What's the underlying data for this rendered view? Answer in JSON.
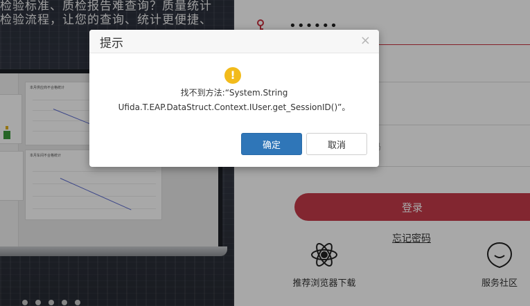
{
  "promo": {
    "line1": "检验标准、质检报告难查询？质量统计",
    "line2": "检验流程，让您的查询、统计更便捷、"
  },
  "laptop_cards": {
    "card1_title": "本月供应商不合格统计",
    "card2_title": "本月车间不合格统计",
    "card3_title": "本月车间不合格统计"
  },
  "login": {
    "password_value": "••••••",
    "login_button": "登录",
    "forgot_password": "忘记密码",
    "browser_download": "推荐浏览器下载",
    "service_community": "服务社区",
    "field_hint": "码"
  },
  "carousel": {
    "dot_count": 5
  },
  "dialog": {
    "title": "提示",
    "close_symbol": "×",
    "warn_symbol": "!",
    "message_line1": "找不到方法:“System.String",
    "message_line2": "Ufida.T.EAP.DataStruct.Context.IUser.get_SessionID()”。",
    "ok_label": "确定",
    "cancel_label": "取消"
  },
  "colors": {
    "accent_red": "#c63a4a",
    "ok_blue": "#2f76b8",
    "warning_yellow": "#f2bb1b"
  }
}
